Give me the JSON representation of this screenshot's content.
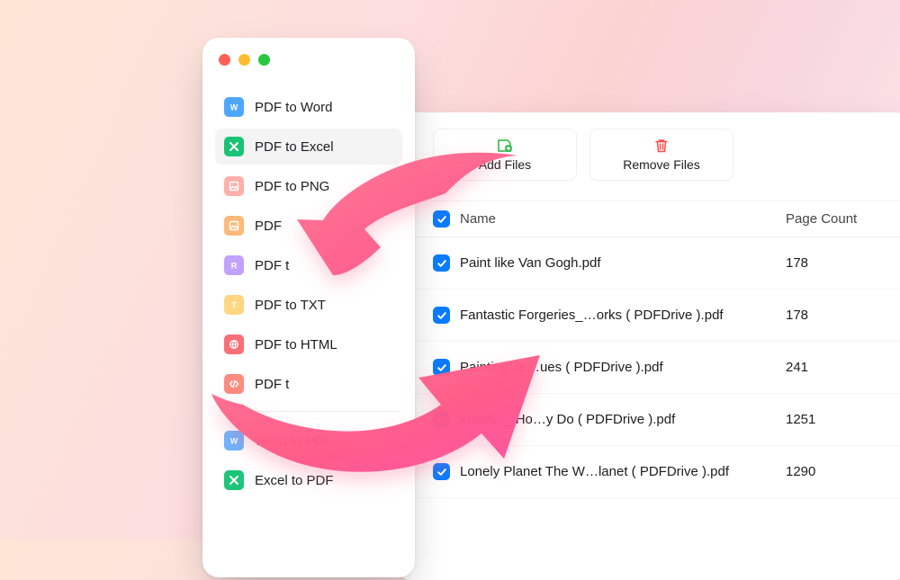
{
  "sidebar": {
    "items": [
      {
        "label": "PDF to Word"
      },
      {
        "label": "PDF to Excel",
        "selected": true
      },
      {
        "label": "PDF to PNG"
      },
      {
        "label": "PDF"
      },
      {
        "label": "PDF t"
      },
      {
        "label": "PDF to TXT"
      },
      {
        "label": "PDF to HTML"
      },
      {
        "label": "PDF t"
      }
    ],
    "group2": [
      {
        "label": "Word to PDF"
      },
      {
        "label": "Excel to PDF"
      }
    ]
  },
  "toolbar": {
    "add": "Add Files",
    "remove": "Remove Files"
  },
  "table": {
    "name_header": "Name",
    "pages_header": "Page Count",
    "rows": [
      {
        "name": "Paint like Van Gogh.pdf",
        "pages": "178"
      },
      {
        "name": "Fantastic Forgeries_…orks ( PDFDrive ).pdf",
        "pages": "178"
      },
      {
        "name": "Painting Te…ues ( PDFDrive ).pdf",
        "pages": "241"
      },
      {
        "name": "ehavior_ Ho…y Do ( PDFDrive ).pdf",
        "pages": "1251"
      },
      {
        "name": "Lonely Planet The W…lanet ( PDFDrive ).pdf",
        "pages": "1290"
      }
    ]
  }
}
